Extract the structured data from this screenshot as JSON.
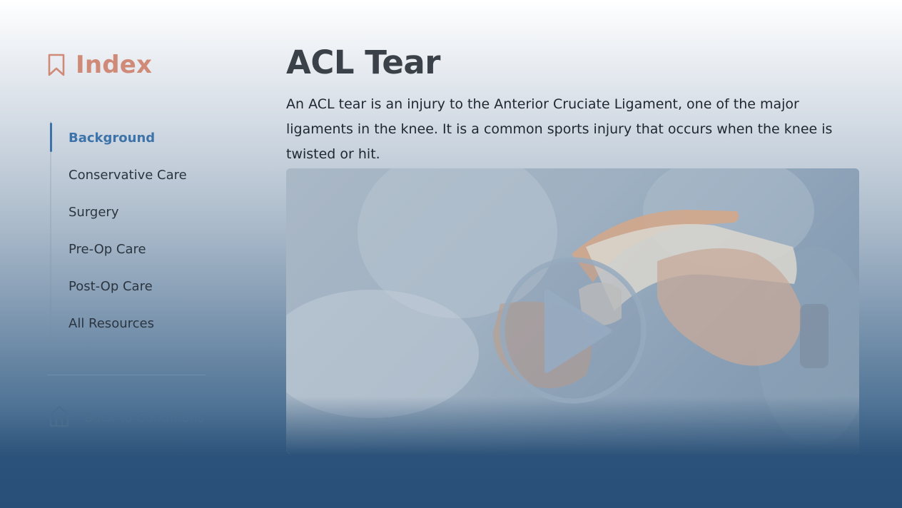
{
  "sidebar": {
    "index_title": "Index",
    "index_icon": "bookmark-icon",
    "items": [
      {
        "label": "Background",
        "active": true
      },
      {
        "label": "Conservative Care",
        "active": false
      },
      {
        "label": "Surgery",
        "active": false
      },
      {
        "label": "Pre-Op Care",
        "active": false
      },
      {
        "label": "Post-Op Care",
        "active": false
      },
      {
        "label": "All Resources",
        "active": false
      }
    ],
    "back_link": {
      "label": "Back to Conditions",
      "icon": "home-icon"
    }
  },
  "main": {
    "title": "ACL Tear",
    "description": "An ACL tear is an injury to the Anterior Cruciate Ligament, one of the major ligaments in the knee. It is a common sports injury that occurs when the knee is twisted or hit.",
    "video": {
      "play_icon": "play-icon"
    }
  },
  "colors": {
    "accent": "#3d73a8",
    "index_title": "#cf8a78",
    "title_text": "#3b4148",
    "background_bottom": "#274f77"
  }
}
